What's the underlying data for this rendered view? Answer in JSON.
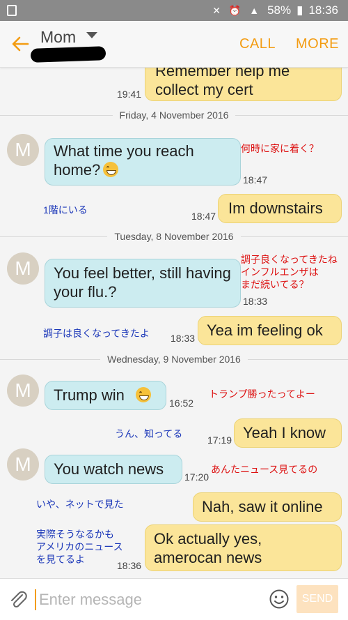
{
  "status_bar": {
    "battery": "58%",
    "time": "18:36"
  },
  "header": {
    "contact_name": "Mom",
    "call_label": "CALL",
    "more_label": "MORE"
  },
  "avatar_letter": "M",
  "dates": [
    "Friday, 4 November 2016",
    "Tuesday, 8 November 2016",
    "Wednesday, 9 November 2016"
  ],
  "messages": [
    {
      "dir": "out",
      "text": "Remember help me collect my cert",
      "time": "19:41"
    },
    {
      "dir": "in",
      "text": "What time you reach home?",
      "time": "18:47"
    },
    {
      "dir": "out",
      "text": "Im downstairs",
      "time": "18:47"
    },
    {
      "dir": "in",
      "text": " You feel better, still having your flu.?",
      "time": "18:33"
    },
    {
      "dir": "out",
      "text": "Yea im feeling ok",
      "time": "18:33"
    },
    {
      "dir": "in",
      "text": "Trump win",
      "time": "16:52"
    },
    {
      "dir": "out",
      "text": "Yeah I know",
      "time": "17:19"
    },
    {
      "dir": "in",
      "text": "You watch news",
      "time": "17:20"
    },
    {
      "dir": "out",
      "text": "Nah, saw it online",
      "time": ""
    },
    {
      "dir": "out",
      "text": "Ok actually yes, amerocan news",
      "time": "18:36"
    }
  ],
  "annotations": [
    {
      "text": "何時に家に着く？",
      "color": "red"
    },
    {
      "text": "1階にいる",
      "color": "blue"
    },
    {
      "text": "調子良くなってきたね\nインフルエンザは\nまだ続いてる？",
      "color": "red"
    },
    {
      "text": "調子は良くなってきたよ",
      "color": "blue"
    },
    {
      "text": "トランプ勝ったってよー",
      "color": "red"
    },
    {
      "text": "うん、知ってる",
      "color": "blue"
    },
    {
      "text": "あんたニュース見てるの",
      "color": "red"
    },
    {
      "text": "いや、ネットで見た",
      "color": "blue"
    },
    {
      "text": "実際そうなるかも\nアメリカのニュース\nを見てるよ",
      "color": "blue"
    }
  ],
  "composer": {
    "placeholder": "Enter message",
    "send_label": "SEND"
  },
  "colors": {
    "accent": "#f39c12",
    "incoming": "#ccecf0",
    "outgoing": "#fbe599",
    "annotation_red": "#dd1111",
    "annotation_blue": "#1a36b8"
  },
  "icons": [
    "back-arrow-icon",
    "dropdown-caret-icon",
    "attach-icon",
    "emoji-icon"
  ]
}
